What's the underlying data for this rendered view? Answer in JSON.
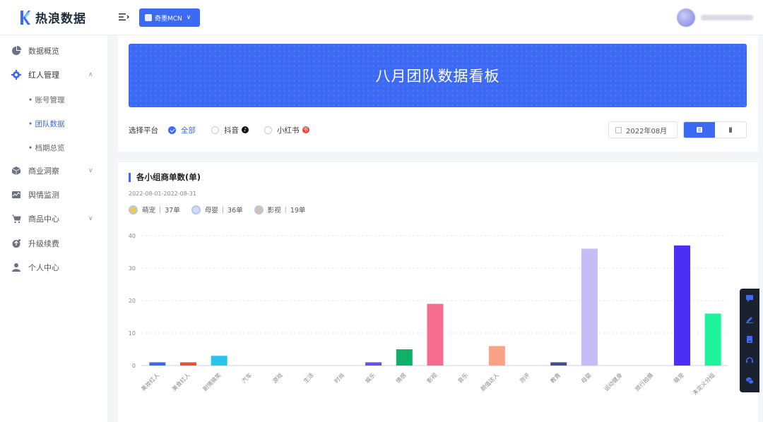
{
  "header": {
    "logo_text": "热浪数据",
    "mcn_label": "奇墨MCN"
  },
  "sidebar": {
    "items": [
      {
        "label": "数据概览",
        "icon": "pie-chart-icon"
      },
      {
        "label": "红人管理",
        "icon": "gear-icon"
      },
      {
        "label": "商业洞察",
        "icon": "cube-icon"
      },
      {
        "label": "舆情监测",
        "icon": "monitor-icon"
      },
      {
        "label": "商品中心",
        "icon": "cart-icon"
      },
      {
        "label": "升级续费",
        "icon": "upgrade-icon"
      },
      {
        "label": "个人中心",
        "icon": "user-icon"
      }
    ],
    "subitems": [
      {
        "label": "• 账号管理"
      },
      {
        "label": "• 团队数据"
      },
      {
        "label": "• 档期总览"
      }
    ]
  },
  "banner": {
    "title": "八月团队数据看板"
  },
  "filters": {
    "platform_label": "选择平台",
    "options": [
      "全部",
      "抖音",
      "小红书"
    ],
    "selected": "全部",
    "date": "2022年08月"
  },
  "chart_section": {
    "title": "各小组商单数(单)",
    "range": "2022-08-01-2022-08-31",
    "summary": [
      {
        "name": "萌宠",
        "count": "37单",
        "medal_color": "#f1c94a"
      },
      {
        "name": "母婴",
        "count": "36单",
        "medal_color": "#cfdcf4"
      },
      {
        "name": "影视",
        "count": "19单",
        "medal_color": "#d6c4a4"
      }
    ]
  },
  "chart_data": {
    "type": "bar",
    "categories": [
      "美妆红人",
      "美食红人",
      "剧情搞笑",
      "汽车",
      "游戏",
      "生活",
      "时尚",
      "娱乐",
      "情感",
      "影视",
      "音乐",
      "颜值达人",
      "测评",
      "教育",
      "母婴",
      "运动健身",
      "旅行拍摄",
      "萌宠",
      "未定义分组"
    ],
    "values": [
      1,
      1,
      3,
      0,
      0,
      0,
      0,
      1,
      5,
      19,
      0,
      6,
      0,
      1,
      36,
      0,
      0,
      37,
      16
    ],
    "colors": [
      "#3d6af5",
      "#e8542f",
      "#28c3f0",
      "#999999",
      "#999999",
      "#999999",
      "#999999",
      "#6a4cf5",
      "#0fb06a",
      "#f76d8f",
      "#999999",
      "#f9a386",
      "#999999",
      "#43508a",
      "#c6bdf8",
      "#999999",
      "#999999",
      "#4b2ff5",
      "#1ef59a"
    ],
    "yticks": [
      0,
      10,
      20,
      30,
      40
    ],
    "ylim": [
      0,
      40
    ],
    "grid": true
  }
}
